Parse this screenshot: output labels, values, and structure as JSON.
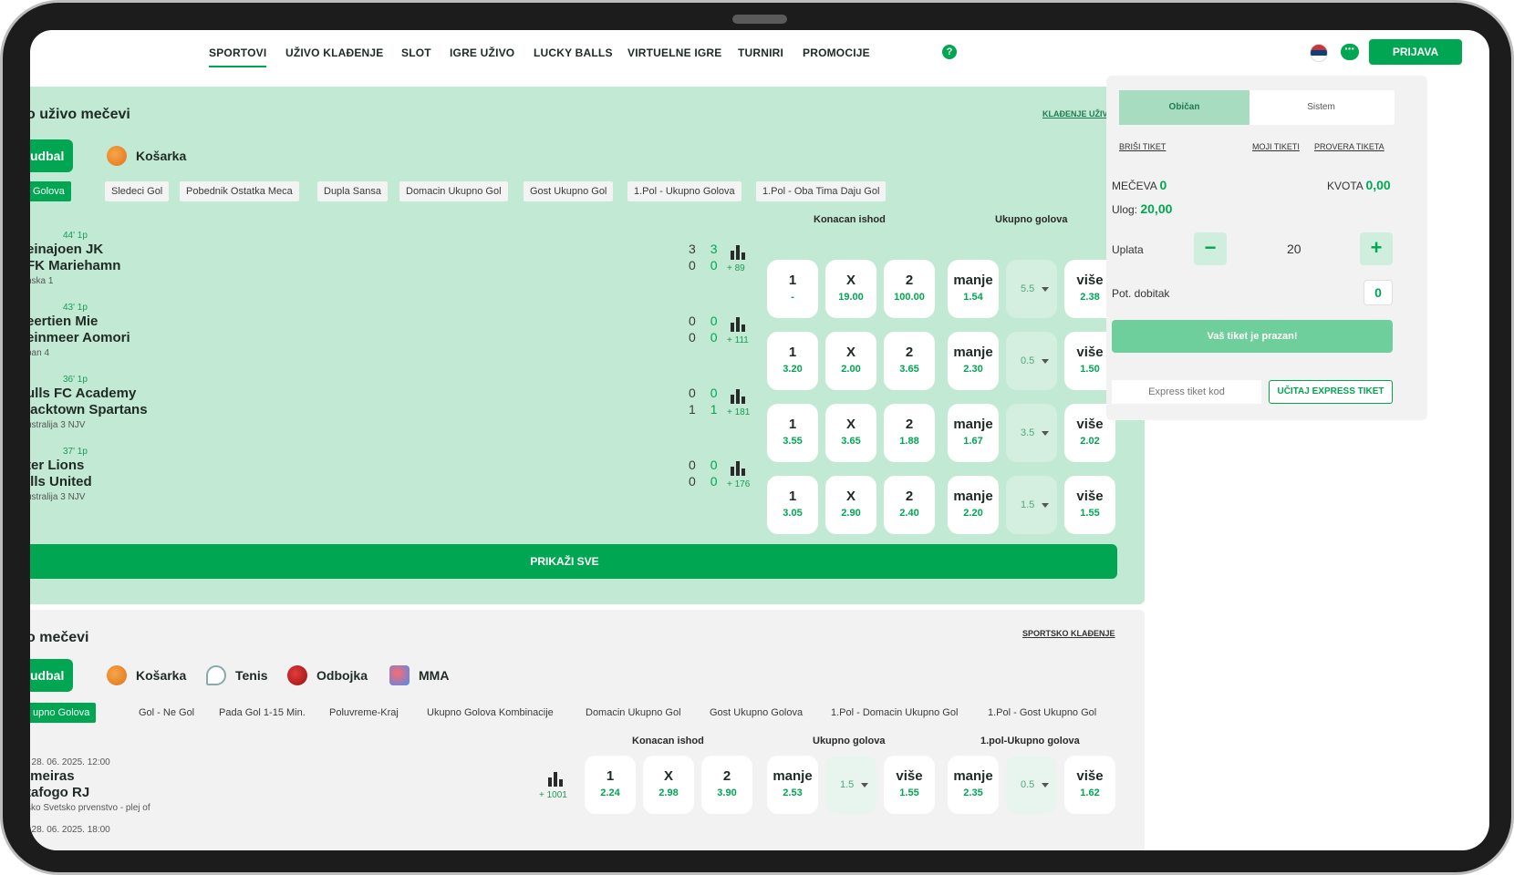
{
  "nav": {
    "items": [
      {
        "label": "SPORTOVI"
      },
      {
        "label": "UŽIVO KLAĐENJE"
      },
      {
        "label": "SLOT"
      },
      {
        "label": "IGRE UŽIVO"
      },
      {
        "label": "LUCKY BALLS"
      },
      {
        "label": "VIRTUELNE IGRE"
      },
      {
        "label": "TURNIRI"
      },
      {
        "label": "PROMOCIJE"
      }
    ],
    "help": "?",
    "login": "PRIJAVA"
  },
  "live": {
    "title": "o uživo mečevi",
    "link": "KLAĐENJE UŽIVO",
    "sports": [
      {
        "label": "udbal"
      },
      {
        "label": "Košarka"
      }
    ],
    "markets": [
      "Golova",
      "Sledeci Gol",
      "Pobednik Ostatka Meca",
      "Dupla Sansa",
      "Domacin Ukupno Gol",
      "Gost Ukupno Gol",
      "1.Pol - Ukupno Golova",
      "1.Pol - Oba Tima Daju Gol"
    ],
    "headers": [
      "Konacan ishod",
      "Ukupno golova"
    ],
    "matches": [
      {
        "time": "44' 1p",
        "home": "einajoen JK",
        "away": "FK Mariehamn",
        "league": "nska 1",
        "score_home": [
          "3",
          "3"
        ],
        "score_away": [
          "0",
          "0"
        ],
        "more": "+ 89",
        "o1": {
          "label": "1",
          "value": "-"
        },
        "ox": {
          "label": "X",
          "value": "19.00"
        },
        "o2": {
          "label": "2",
          "value": "100.00"
        },
        "under": {
          "label": "manje",
          "value": "1.54"
        },
        "line": "5.5",
        "over": {
          "label": "više",
          "value": "2.38"
        }
      },
      {
        "time": "43' 1p",
        "home": "eertien Mie",
        "away": "einmeer Aomori",
        "league": "pan 4",
        "score_home": [
          "0",
          "0"
        ],
        "score_away": [
          "0",
          "0"
        ],
        "more": "+ 111",
        "o1": {
          "label": "1",
          "value": "3.20"
        },
        "ox": {
          "label": "X",
          "value": "2.00"
        },
        "o2": {
          "label": "2",
          "value": "3.65"
        },
        "under": {
          "label": "manje",
          "value": "2.30"
        },
        "line": "0.5",
        "over": {
          "label": "više",
          "value": "1.50"
        }
      },
      {
        "time": "36' 1p",
        "home": "ulls FC Academy",
        "away": "lacktown Spartans",
        "league": "ustralija 3 NJV",
        "score_home": [
          "0",
          "0"
        ],
        "score_away": [
          "1",
          "1"
        ],
        "more": "+ 181",
        "o1": {
          "label": "1",
          "value": "3.55"
        },
        "ox": {
          "label": "X",
          "value": "3.65"
        },
        "o2": {
          "label": "2",
          "value": "1.88"
        },
        "under": {
          "label": "manje",
          "value": "1.67"
        },
        "line": "3.5",
        "over": {
          "label": "više",
          "value": "2.02"
        }
      },
      {
        "time": "37' 1p",
        "home": "ter Lions",
        "away": "ills United",
        "league": "ustralija 3 NJV",
        "score_home": [
          "0",
          "0"
        ],
        "score_away": [
          "0",
          "0"
        ],
        "more": "+ 176",
        "o1": {
          "label": "1",
          "value": "3.05"
        },
        "ox": {
          "label": "X",
          "value": "2.90"
        },
        "o2": {
          "label": "2",
          "value": "2.40"
        },
        "under": {
          "label": "manje",
          "value": "2.20"
        },
        "line": "1.5",
        "over": {
          "label": "više",
          "value": "1.55"
        }
      }
    ],
    "show_all": "PRIKAŽI SVE"
  },
  "pre": {
    "title": "o mečevi",
    "link": "SPORTSKO KLAĐENJE",
    "sports": [
      {
        "label": "udbal"
      },
      {
        "label": "Košarka"
      },
      {
        "label": "Tenis"
      },
      {
        "label": "Odbojka"
      },
      {
        "label": "MMA"
      }
    ],
    "markets": [
      "upno Golova",
      "Gol - Ne Gol",
      "Pada Gol 1-15 Min.",
      "Poluvreme-Kraj",
      "Ukupno Golova Kombinacije",
      "Domacin Ukupno Gol",
      "Gost Ukupno Golova",
      "1.Pol - Domacin Ukupno Gol",
      "1.Pol - Gost Ukupno Gol"
    ],
    "headers": [
      "Konacan ishod",
      "Ukupno golova",
      "1.pol-Ukupno golova"
    ],
    "match": {
      "date": ", 28. 06. 2025. 12:00",
      "home": "lmeiras",
      "away": "tafogo RJ",
      "league": "sko Svetsko prvenstvo - plej of",
      "more": "+ 1001",
      "o1": {
        "label": "1",
        "value": "2.24"
      },
      "ox": {
        "label": "X",
        "value": "2.98"
      },
      "o2": {
        "label": "2",
        "value": "3.90"
      },
      "under": {
        "label": "manje",
        "value": "2.53"
      },
      "line": "1.5",
      "over": {
        "label": "više",
        "value": "1.55"
      },
      "h_under": {
        "label": "manje",
        "value": "2.35"
      },
      "h_line": "0.5",
      "h_over": {
        "label": "više",
        "value": "1.62"
      }
    },
    "next_date": ", 28. 06. 2025. 18:00"
  },
  "slip": {
    "tabs": [
      "Običan",
      "Sistem"
    ],
    "links": [
      "BRIŠI TIKET",
      "MOJI TIKETI",
      "PROVERA TIKETA"
    ],
    "matches_label": "MEČEVA",
    "matches_value": "0",
    "odds_label": "KVOTA",
    "odds_value": "0,00",
    "stake_label": "Ulog:",
    "stake_value": "20,00",
    "payment_label": "Uplata",
    "payment_value": "20",
    "minus": "−",
    "plus": "+",
    "potential_label": "Pot. dobitak",
    "potential_value": "0",
    "empty_button": "Vaš tiket je prazan!",
    "express_placeholder": "Express tiket kod",
    "express_button": "UČITAJ EXPRESS TIKET"
  },
  "colors": {
    "accent": "#00a651",
    "live_bg": "#c2e9d4",
    "pre_bg": "#f2f2f2"
  }
}
